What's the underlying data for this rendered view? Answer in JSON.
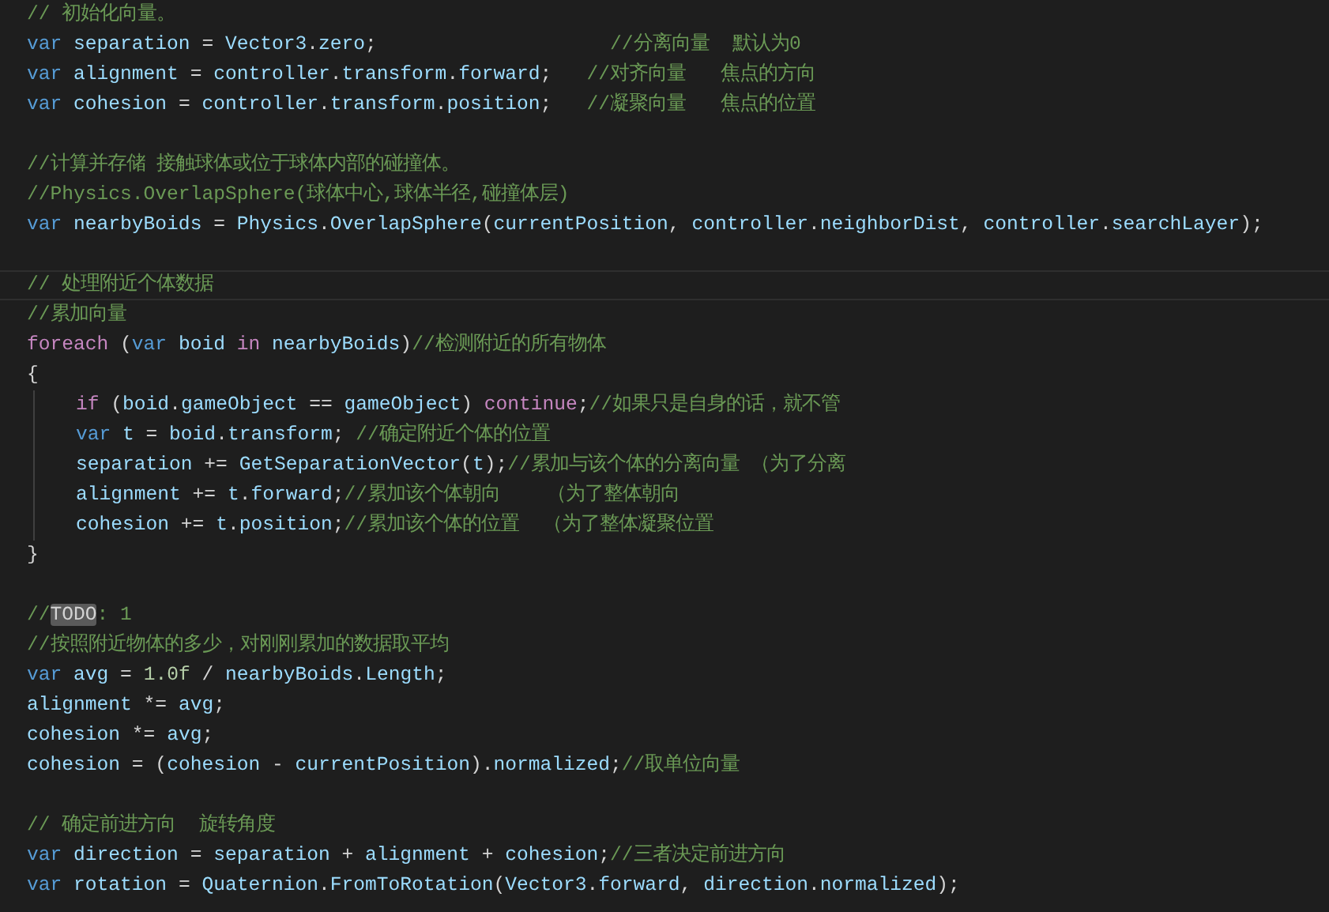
{
  "editor": {
    "lines": [
      {
        "current": false,
        "tokens": [
          {
            "kind": "comment",
            "text": "// 初始化向量。"
          }
        ]
      },
      {
        "current": false,
        "tokens": [
          {
            "kind": "keyword",
            "text": "var"
          },
          {
            "kind": "ident",
            "text": " separation"
          },
          {
            "kind": "plain",
            "text": " = "
          },
          {
            "kind": "ident",
            "text": "Vector3"
          },
          {
            "kind": "plain",
            "text": "."
          },
          {
            "kind": "ident",
            "text": "zero"
          },
          {
            "kind": "plain",
            "text": ";                    "
          },
          {
            "kind": "comment",
            "text": "//分离向量  默认为0"
          }
        ]
      },
      {
        "current": false,
        "tokens": [
          {
            "kind": "keyword",
            "text": "var"
          },
          {
            "kind": "ident",
            "text": " alignment"
          },
          {
            "kind": "plain",
            "text": " = "
          },
          {
            "kind": "ident",
            "text": "controller"
          },
          {
            "kind": "plain",
            "text": "."
          },
          {
            "kind": "ident",
            "text": "transform"
          },
          {
            "kind": "plain",
            "text": "."
          },
          {
            "kind": "ident",
            "text": "forward"
          },
          {
            "kind": "plain",
            "text": ";   "
          },
          {
            "kind": "comment",
            "text": "//对齐向量   焦点的方向"
          }
        ]
      },
      {
        "current": false,
        "tokens": [
          {
            "kind": "keyword",
            "text": "var"
          },
          {
            "kind": "ident",
            "text": " cohesion"
          },
          {
            "kind": "plain",
            "text": " = "
          },
          {
            "kind": "ident",
            "text": "controller"
          },
          {
            "kind": "plain",
            "text": "."
          },
          {
            "kind": "ident",
            "text": "transform"
          },
          {
            "kind": "plain",
            "text": "."
          },
          {
            "kind": "ident",
            "text": "position"
          },
          {
            "kind": "plain",
            "text": ";   "
          },
          {
            "kind": "comment",
            "text": "//凝聚向量   焦点的位置"
          }
        ]
      },
      {
        "current": false
      },
      {
        "current": false,
        "tokens": [
          {
            "kind": "comment",
            "text": "//计算并存储 接触球体或位于球体内部的碰撞体。"
          }
        ]
      },
      {
        "current": false,
        "tokens": [
          {
            "kind": "comment",
            "text": "//Physics.OverlapSphere(球体中心,球体半径,碰撞体层)"
          }
        ]
      },
      {
        "current": false,
        "tokens": [
          {
            "kind": "keyword",
            "text": "var"
          },
          {
            "kind": "ident",
            "text": " nearbyBoids"
          },
          {
            "kind": "plain",
            "text": " = "
          },
          {
            "kind": "ident",
            "text": "Physics"
          },
          {
            "kind": "plain",
            "text": "."
          },
          {
            "kind": "ident",
            "text": "OverlapSphere"
          },
          {
            "kind": "plain",
            "text": "("
          },
          {
            "kind": "ident",
            "text": "currentPosition"
          },
          {
            "kind": "plain",
            "text": ", "
          },
          {
            "kind": "ident",
            "text": "controller"
          },
          {
            "kind": "plain",
            "text": "."
          },
          {
            "kind": "ident",
            "text": "neighborDist"
          },
          {
            "kind": "plain",
            "text": ", "
          },
          {
            "kind": "ident",
            "text": "controller"
          },
          {
            "kind": "plain",
            "text": "."
          },
          {
            "kind": "ident",
            "text": "searchLayer"
          },
          {
            "kind": "plain",
            "text": ");"
          }
        ]
      },
      {
        "current": false
      },
      {
        "current": true,
        "tokens": [
          {
            "kind": "comment",
            "text": "// 处理附近个体数据"
          }
        ]
      },
      {
        "current": false,
        "tokens": [
          {
            "kind": "comment",
            "text": "//累加向量"
          }
        ]
      },
      {
        "current": false,
        "tokens": [
          {
            "kind": "control",
            "text": "foreach"
          },
          {
            "kind": "plain",
            "text": " ("
          },
          {
            "kind": "keyword",
            "text": "var"
          },
          {
            "kind": "ident",
            "text": " boid"
          },
          {
            "kind": "control",
            "text": " in"
          },
          {
            "kind": "ident",
            "text": " nearbyBoids"
          },
          {
            "kind": "plain",
            "text": ")"
          },
          {
            "kind": "comment",
            "text": "//检测附近的所有物体"
          }
        ]
      },
      {
        "current": false,
        "tokens": [
          {
            "kind": "plain",
            "text": "{"
          }
        ],
        "children": [
          {
            "current": false,
            "tokens": [
              {
                "kind": "control",
                "text": "if"
              },
              {
                "kind": "plain",
                "text": " ("
              },
              {
                "kind": "ident",
                "text": "boid"
              },
              {
                "kind": "plain",
                "text": "."
              },
              {
                "kind": "ident",
                "text": "gameObject"
              },
              {
                "kind": "plain",
                "text": " == "
              },
              {
                "kind": "ident",
                "text": "gameObject"
              },
              {
                "kind": "plain",
                "text": ") "
              },
              {
                "kind": "control",
                "text": "continue"
              },
              {
                "kind": "plain",
                "text": ";"
              },
              {
                "kind": "comment",
                "text": "//如果只是自身的话，就不管"
              }
            ]
          },
          {
            "current": false,
            "tokens": [
              {
                "kind": "keyword",
                "text": "var"
              },
              {
                "kind": "ident",
                "text": " t"
              },
              {
                "kind": "plain",
                "text": " = "
              },
              {
                "kind": "ident",
                "text": "boid"
              },
              {
                "kind": "plain",
                "text": "."
              },
              {
                "kind": "ident",
                "text": "transform"
              },
              {
                "kind": "plain",
                "text": "; "
              },
              {
                "kind": "comment",
                "text": "//确定附近个体的位置"
              }
            ]
          },
          {
            "current": false,
            "tokens": [
              {
                "kind": "ident",
                "text": "separation"
              },
              {
                "kind": "plain",
                "text": " += "
              },
              {
                "kind": "ident",
                "text": "GetSeparationVector"
              },
              {
                "kind": "plain",
                "text": "("
              },
              {
                "kind": "ident",
                "text": "t"
              },
              {
                "kind": "plain",
                "text": ");"
              },
              {
                "kind": "comment",
                "text": "//累加与该个体的分离向量 （为了分离"
              }
            ]
          },
          {
            "current": false,
            "tokens": [
              {
                "kind": "ident",
                "text": "alignment"
              },
              {
                "kind": "plain",
                "text": " += "
              },
              {
                "kind": "ident",
                "text": "t"
              },
              {
                "kind": "plain",
                "text": "."
              },
              {
                "kind": "ident",
                "text": "forward"
              },
              {
                "kind": "plain",
                "text": ";"
              },
              {
                "kind": "comment",
                "text": "//累加该个体朝向    （为了整体朝向"
              }
            ]
          },
          {
            "current": false,
            "tokens": [
              {
                "kind": "ident",
                "text": "cohesion"
              },
              {
                "kind": "plain",
                "text": " += "
              },
              {
                "kind": "ident",
                "text": "t"
              },
              {
                "kind": "plain",
                "text": "."
              },
              {
                "kind": "ident",
                "text": "position"
              },
              {
                "kind": "plain",
                "text": ";"
              },
              {
                "kind": "comment",
                "text": "//累加该个体的位置  （为了整体凝聚位置"
              }
            ]
          }
        ]
      },
      {
        "current": false,
        "tokens": [
          {
            "kind": "plain",
            "text": "}"
          }
        ]
      },
      {
        "current": false
      },
      {
        "current": false,
        "tokens": [
          {
            "kind": "comment",
            "text": "//"
          },
          {
            "kind": "todo",
            "text": "TODO"
          },
          {
            "kind": "comment",
            "text": ": 1"
          }
        ]
      },
      {
        "current": false,
        "tokens": [
          {
            "kind": "comment",
            "text": "//按照附近物体的多少，对刚刚累加的数据取平均"
          }
        ]
      },
      {
        "current": false,
        "tokens": [
          {
            "kind": "keyword",
            "text": "var"
          },
          {
            "kind": "ident",
            "text": " avg"
          },
          {
            "kind": "plain",
            "text": " = "
          },
          {
            "kind": "number",
            "text": "1.0f"
          },
          {
            "kind": "plain",
            "text": " / "
          },
          {
            "kind": "ident",
            "text": "nearbyBoids"
          },
          {
            "kind": "plain",
            "text": "."
          },
          {
            "kind": "ident",
            "text": "Length"
          },
          {
            "kind": "plain",
            "text": ";"
          }
        ]
      },
      {
        "current": false,
        "tokens": [
          {
            "kind": "ident",
            "text": "alignment"
          },
          {
            "kind": "plain",
            "text": " *= "
          },
          {
            "kind": "ident",
            "text": "avg"
          },
          {
            "kind": "plain",
            "text": ";"
          }
        ]
      },
      {
        "current": false,
        "tokens": [
          {
            "kind": "ident",
            "text": "cohesion"
          },
          {
            "kind": "plain",
            "text": " *= "
          },
          {
            "kind": "ident",
            "text": "avg"
          },
          {
            "kind": "plain",
            "text": ";"
          }
        ]
      },
      {
        "current": false,
        "tokens": [
          {
            "kind": "ident",
            "text": "cohesion"
          },
          {
            "kind": "plain",
            "text": " = ("
          },
          {
            "kind": "ident",
            "text": "cohesion"
          },
          {
            "kind": "plain",
            "text": " - "
          },
          {
            "kind": "ident",
            "text": "currentPosition"
          },
          {
            "kind": "plain",
            "text": ")."
          },
          {
            "kind": "ident",
            "text": "normalized"
          },
          {
            "kind": "plain",
            "text": ";"
          },
          {
            "kind": "comment",
            "text": "//取单位向量"
          }
        ]
      },
      {
        "current": false
      },
      {
        "current": false,
        "tokens": [
          {
            "kind": "comment",
            "text": "// 确定前进方向  旋转角度"
          }
        ]
      },
      {
        "current": false,
        "tokens": [
          {
            "kind": "keyword",
            "text": "var"
          },
          {
            "kind": "ident",
            "text": " direction"
          },
          {
            "kind": "plain",
            "text": " = "
          },
          {
            "kind": "ident",
            "text": "separation"
          },
          {
            "kind": "plain",
            "text": " + "
          },
          {
            "kind": "ident",
            "text": "alignment"
          },
          {
            "kind": "plain",
            "text": " + "
          },
          {
            "kind": "ident",
            "text": "cohesion"
          },
          {
            "kind": "plain",
            "text": ";"
          },
          {
            "kind": "comment",
            "text": "//三者决定前进方向"
          }
        ]
      },
      {
        "current": false,
        "tokens": [
          {
            "kind": "keyword",
            "text": "var"
          },
          {
            "kind": "ident",
            "text": " rotation"
          },
          {
            "kind": "plain",
            "text": " = "
          },
          {
            "kind": "ident",
            "text": "Quaternion"
          },
          {
            "kind": "plain",
            "text": "."
          },
          {
            "kind": "ident",
            "text": "FromToRotation"
          },
          {
            "kind": "plain",
            "text": "("
          },
          {
            "kind": "ident",
            "text": "Vector3"
          },
          {
            "kind": "plain",
            "text": "."
          },
          {
            "kind": "ident",
            "text": "forward"
          },
          {
            "kind": "plain",
            "text": ", "
          },
          {
            "kind": "ident",
            "text": "direction"
          },
          {
            "kind": "plain",
            "text": "."
          },
          {
            "kind": "ident",
            "text": "normalized"
          },
          {
            "kind": "plain",
            "text": ");"
          }
        ]
      }
    ]
  }
}
